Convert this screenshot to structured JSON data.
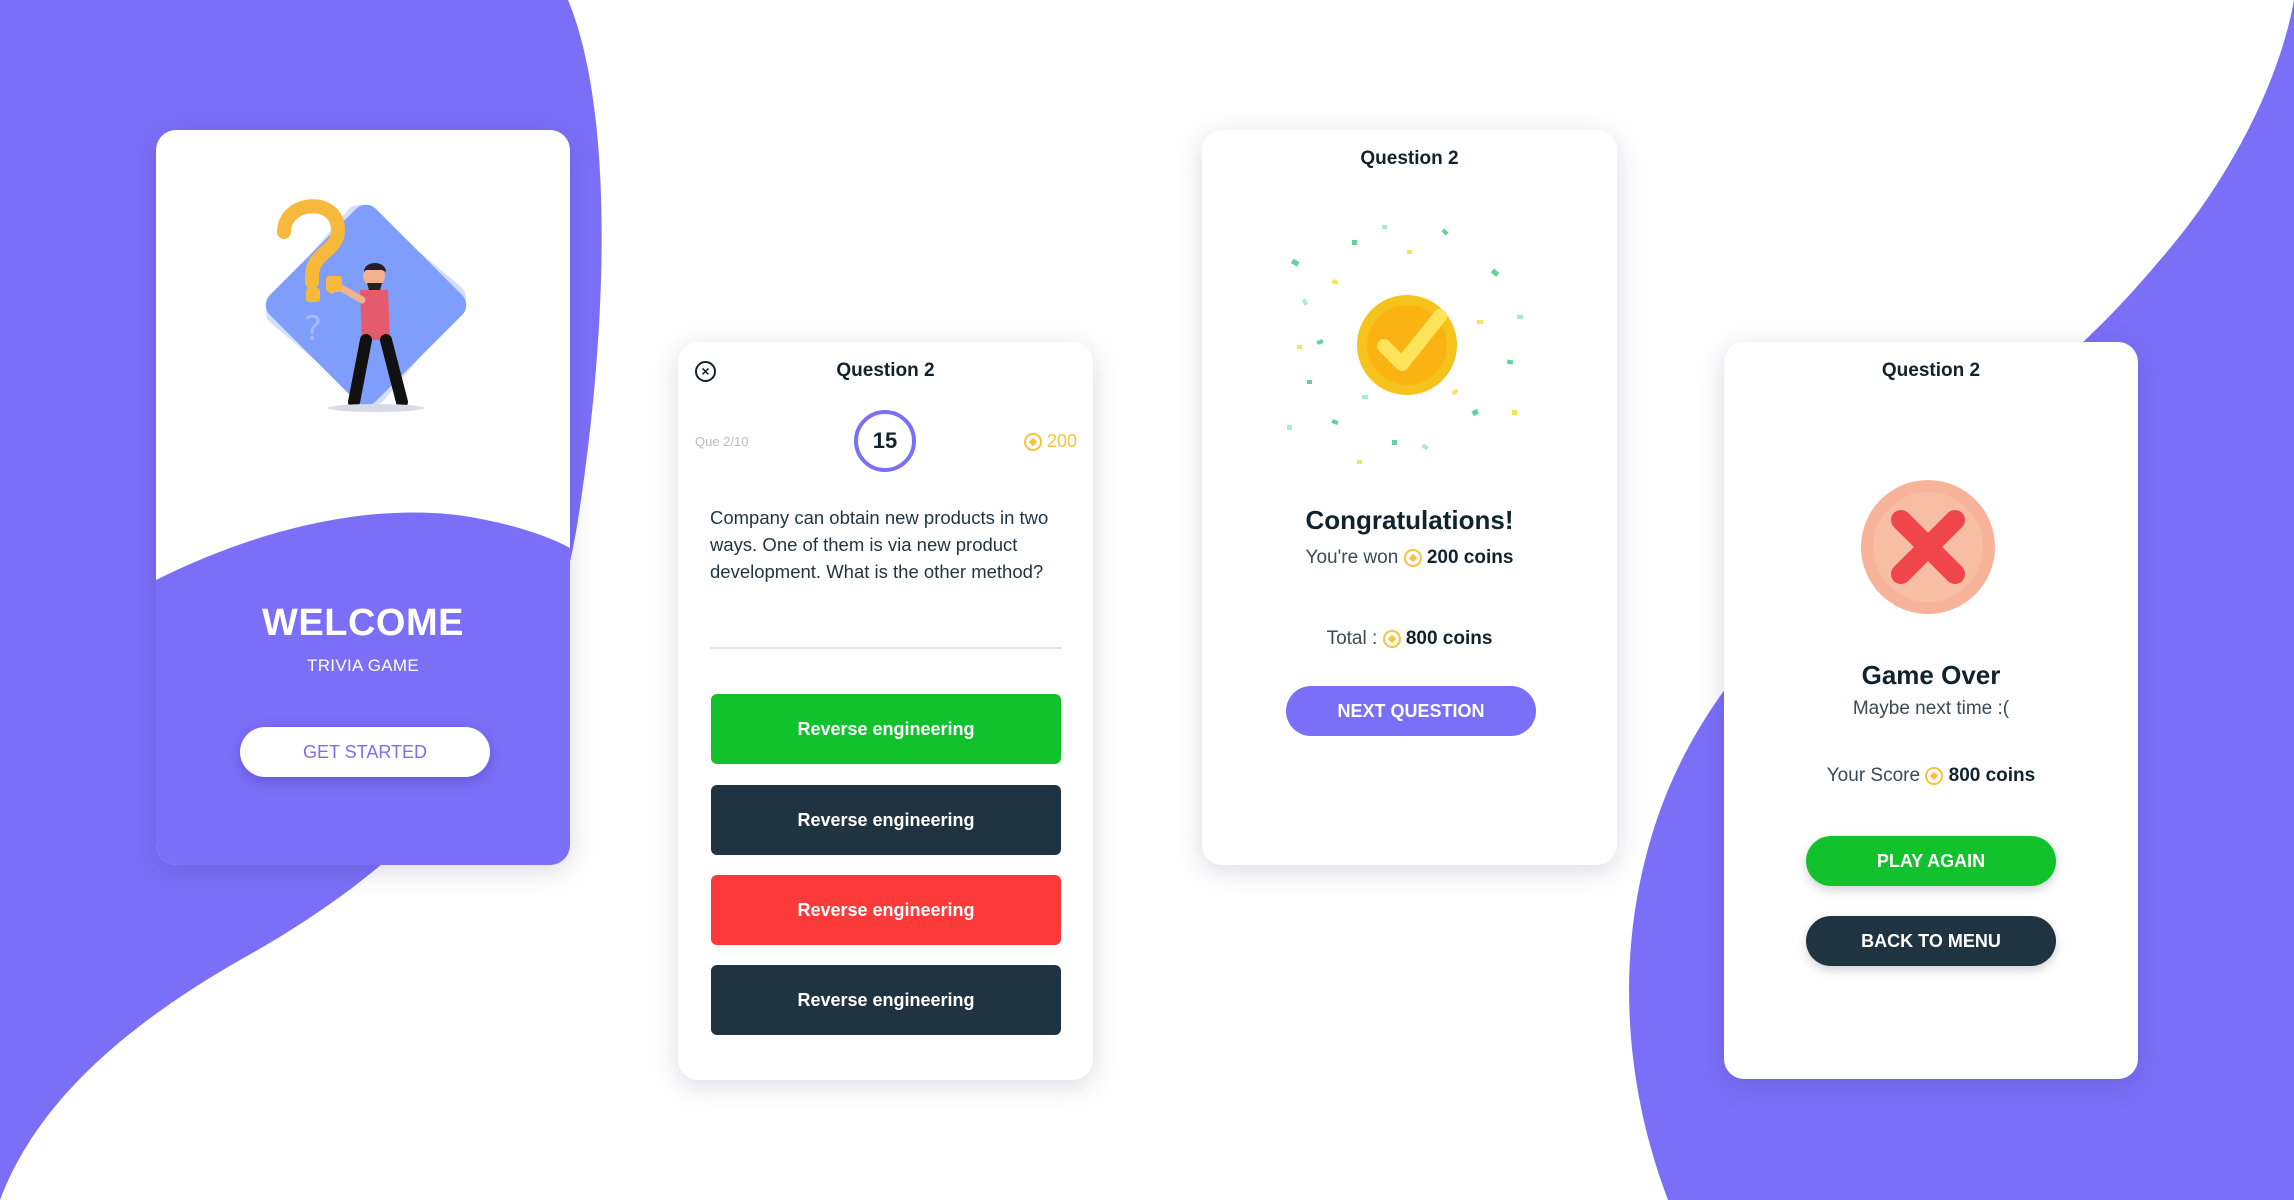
{
  "colors": {
    "primary_purple": "#7b6ff8",
    "green": "#12c22c",
    "dark": "#1f3440",
    "red": "#fc3a3a",
    "coin_gold": "#f6c33e"
  },
  "welcome": {
    "title": "WELCOME",
    "subtitle": "TRIVIA GAME",
    "get_started_label": "GET STARTED"
  },
  "question": {
    "title": "Question 2",
    "progress": "Que 2/10",
    "timer": "15",
    "coins": "200",
    "text": "Company can obtain new products in two ways. One of them is via new product development. What is the other method?",
    "answers": [
      {
        "label": "Reverse engineering",
        "state": "correct",
        "color": "#12c22c"
      },
      {
        "label": "Reverse engineering",
        "state": "default",
        "color": "#1f3440"
      },
      {
        "label": "Reverse engineering",
        "state": "wrong",
        "color": "#fc3a3a"
      },
      {
        "label": "Reverse engineering",
        "state": "default",
        "color": "#1f3440"
      }
    ]
  },
  "congrats": {
    "title": "Question 2",
    "heading": "Congratulations!",
    "won_prefix": "You're won",
    "won_amount": "200 coins",
    "total_prefix": "Total :",
    "total_amount": "800 coins",
    "next_label": "NEXT QUESTION"
  },
  "gameover": {
    "title": "Question 2",
    "heading": "Game Over",
    "subtitle": "Maybe next time :(",
    "score_prefix": "Your Score",
    "score_amount": "800 coins",
    "play_again_label": "PLAY AGAIN",
    "back_menu_label": "BACK TO MENU"
  },
  "icons": {
    "close": "close-circle-icon",
    "coin": "coin-icon",
    "success": "checkmark-medal-icon",
    "fail": "red-x-icon"
  }
}
